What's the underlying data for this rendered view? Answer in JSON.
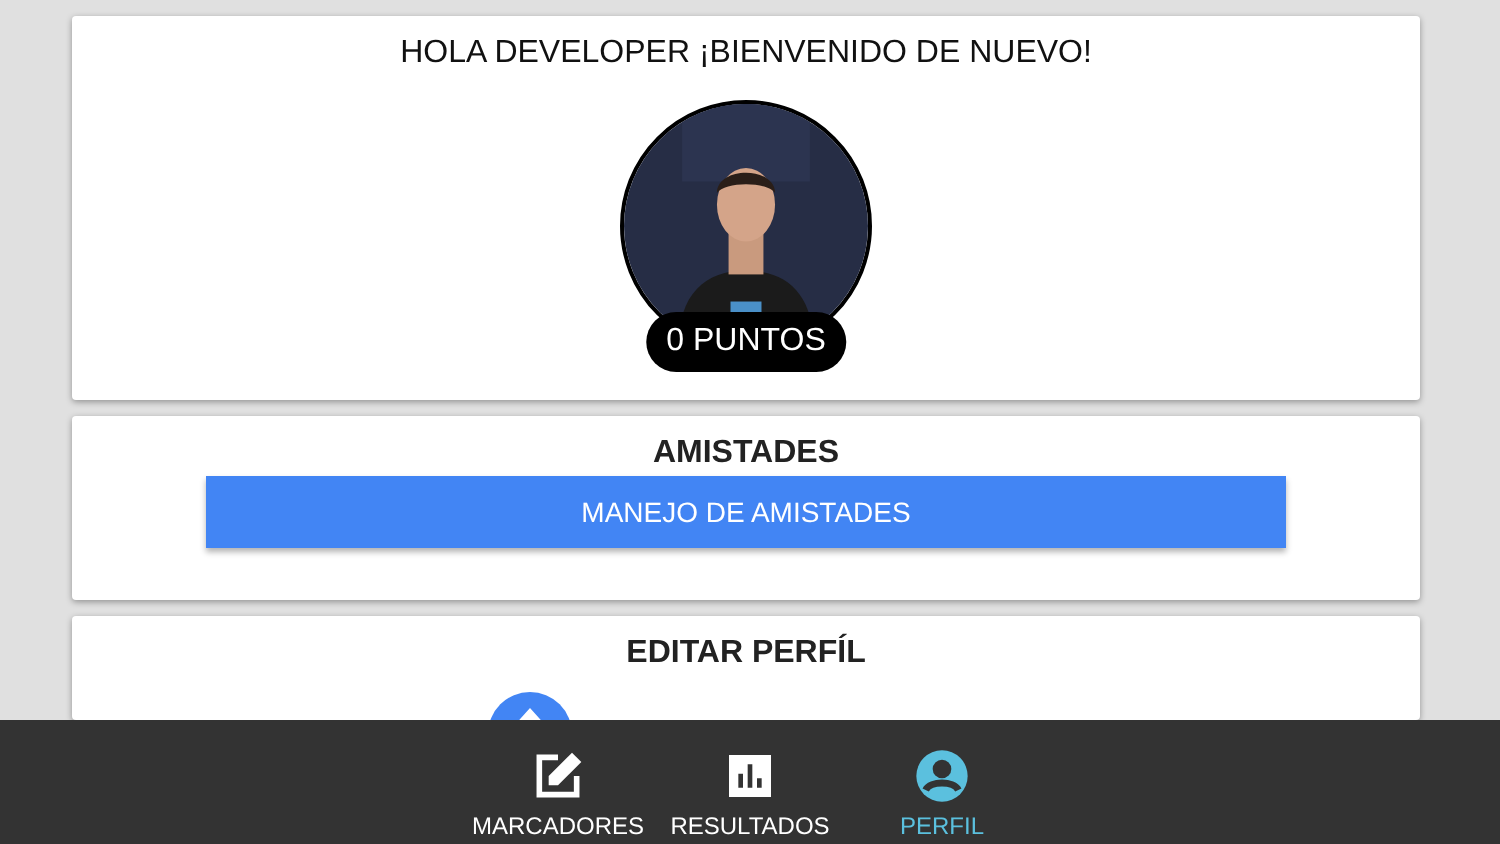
{
  "greeting": "HOLA DEVELOPER ¡BIENVENIDO DE NUEVO!",
  "profile": {
    "points": "0 PUNTOS"
  },
  "friends": {
    "title": "AMISTADES",
    "button": "MANEJO DE AMISTADES"
  },
  "edit_profile": {
    "title": "EDITAR PERFÍL"
  },
  "nav": [
    {
      "label": "MARCADORES",
      "kind": "edit",
      "selected": false
    },
    {
      "label": "RESULTADOS",
      "kind": "chart",
      "selected": false
    },
    {
      "label": "PERFIL",
      "kind": "person",
      "selected": true
    }
  ]
}
